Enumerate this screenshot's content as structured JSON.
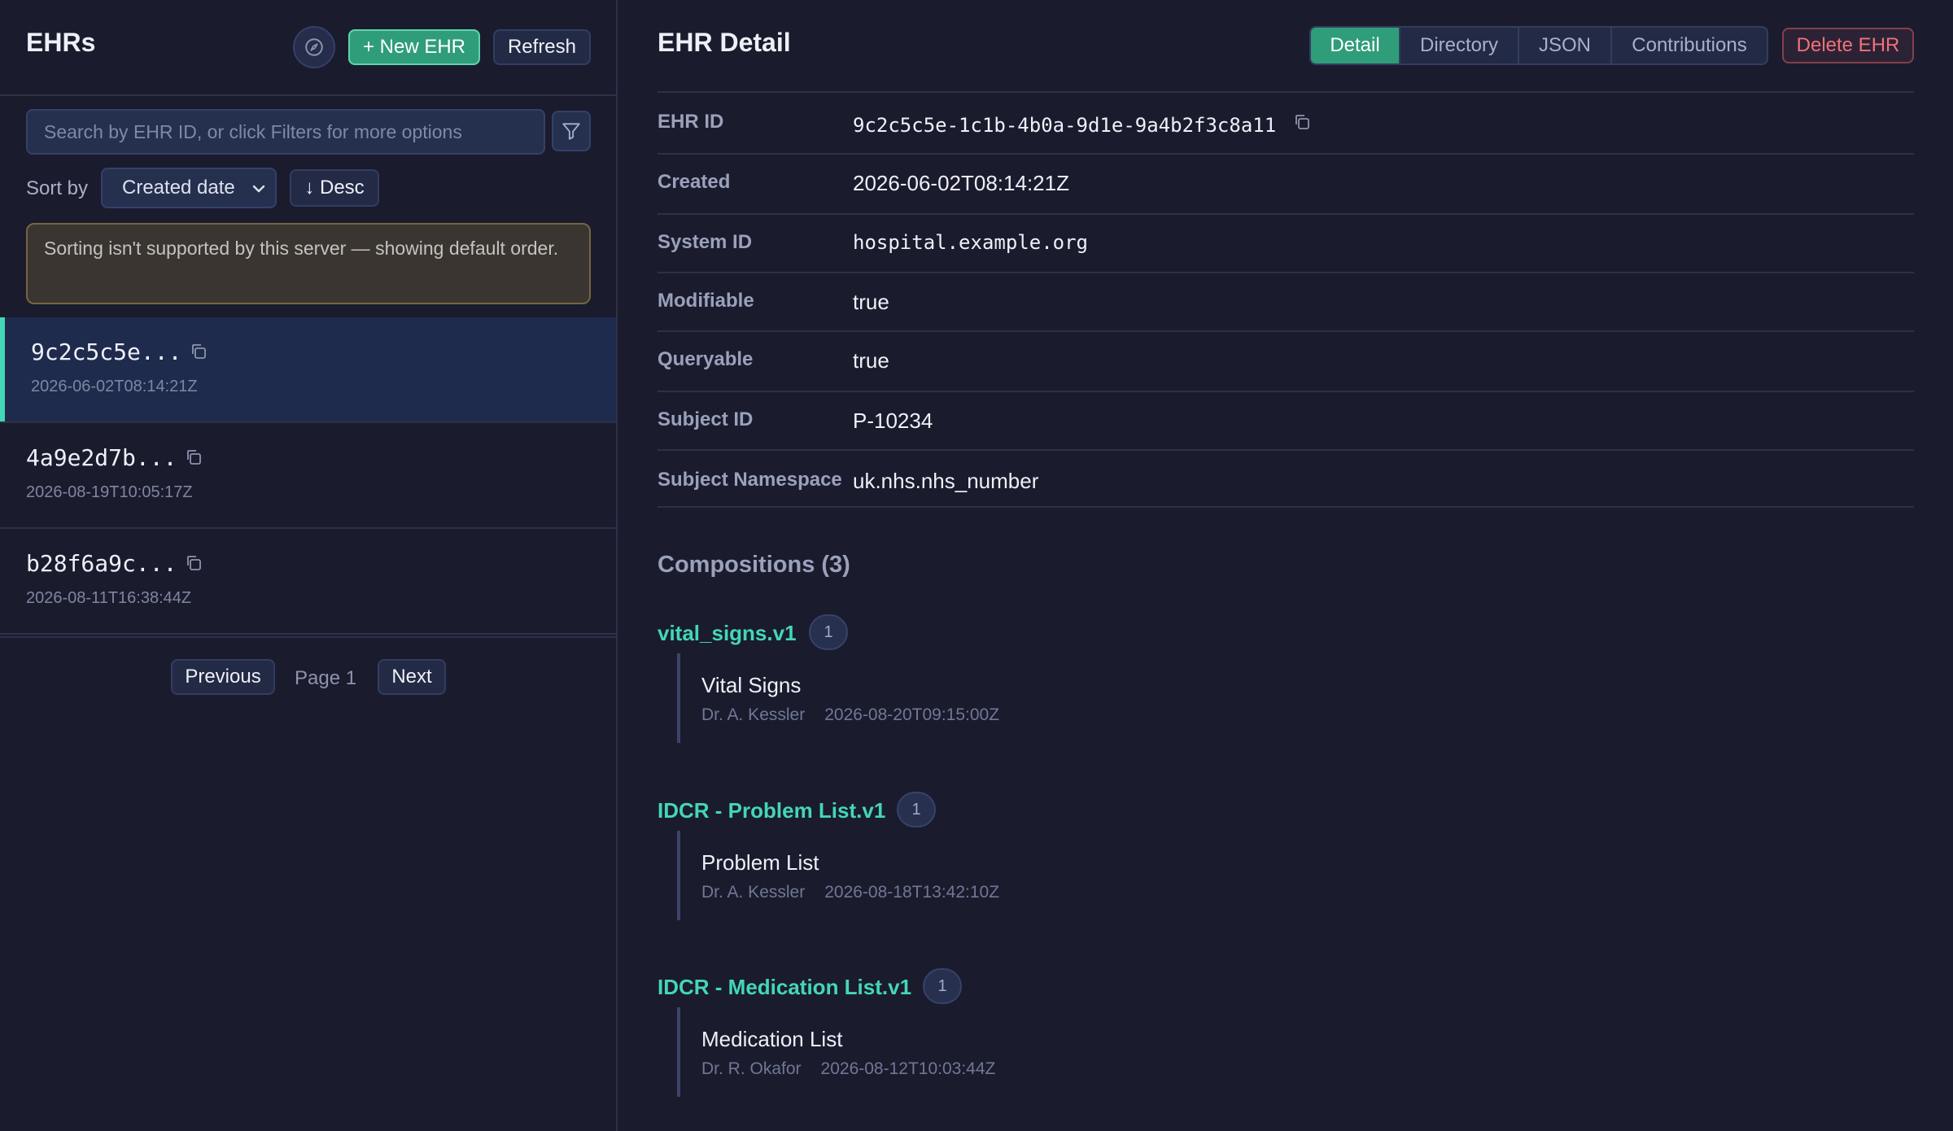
{
  "sidebar": {
    "title": "EHRs",
    "new_button": "+ New EHR",
    "refresh_button": "Refresh",
    "search_placeholder": "Search by EHR ID, or click Filters for more options",
    "sort_label": "Sort by",
    "sort_value": "Created date",
    "order_button": "↓ Desc",
    "warning": "Sorting isn't supported by this server — showing default order.",
    "items": [
      {
        "id": "9c2c5c5e...",
        "date": "2026-06-02T08:14:21Z",
        "selected": true
      },
      {
        "id": "4a9e2d7b...",
        "date": "2026-08-19T10:05:17Z",
        "selected": false
      },
      {
        "id": "b28f6a9c...",
        "date": "2026-08-11T16:38:44Z",
        "selected": false
      }
    ],
    "pagination": {
      "previous": "Previous",
      "page": "Page 1",
      "next": "Next"
    }
  },
  "detail": {
    "title": "EHR Detail",
    "tabs": [
      "Detail",
      "Directory",
      "JSON",
      "Contributions"
    ],
    "active_tab": "Detail",
    "delete_button": "Delete EHR",
    "fields": [
      {
        "label": "EHR ID",
        "value": "9c2c5c5e-1c1b-4b0a-9d1e-9a4b2f3c8a11"
      },
      {
        "label": "Created",
        "value": "2026-06-02T08:14:21Z"
      },
      {
        "label": "System ID",
        "value": "hospital.example.org"
      },
      {
        "label": "Modifiable",
        "value": "true"
      },
      {
        "label": "Queryable",
        "value": "true"
      },
      {
        "label": "Subject ID",
        "value": "P-10234"
      },
      {
        "label": "Subject Namespace",
        "value": "uk.nhs.nhs_number"
      }
    ]
  },
  "compositions": {
    "heading": "Compositions (3)",
    "groups": [
      {
        "template": "vital_signs.v1",
        "count": "1",
        "entries": [
          {
            "title": "Vital Signs",
            "author": "Dr. A. Kessler",
            "time": "2026-08-20T09:15:00Z"
          }
        ]
      },
      {
        "template": "IDCR - Problem List.v1",
        "count": "1",
        "entries": [
          {
            "title": "Problem List",
            "author": "Dr. A. Kessler",
            "time": "2026-08-18T13:42:10Z"
          }
        ]
      },
      {
        "template": "IDCR - Medication List.v1",
        "count": "1",
        "entries": [
          {
            "title": "Medication List",
            "author": "Dr. R. Okafor",
            "time": "2026-08-12T10:03:44Z"
          }
        ]
      }
    ]
  },
  "colors": {
    "background": "#1b1b2e",
    "accent": "#42d7b6",
    "primary_button": "#2f9d79",
    "danger": "#f07178",
    "warning_border": "#786543"
  }
}
